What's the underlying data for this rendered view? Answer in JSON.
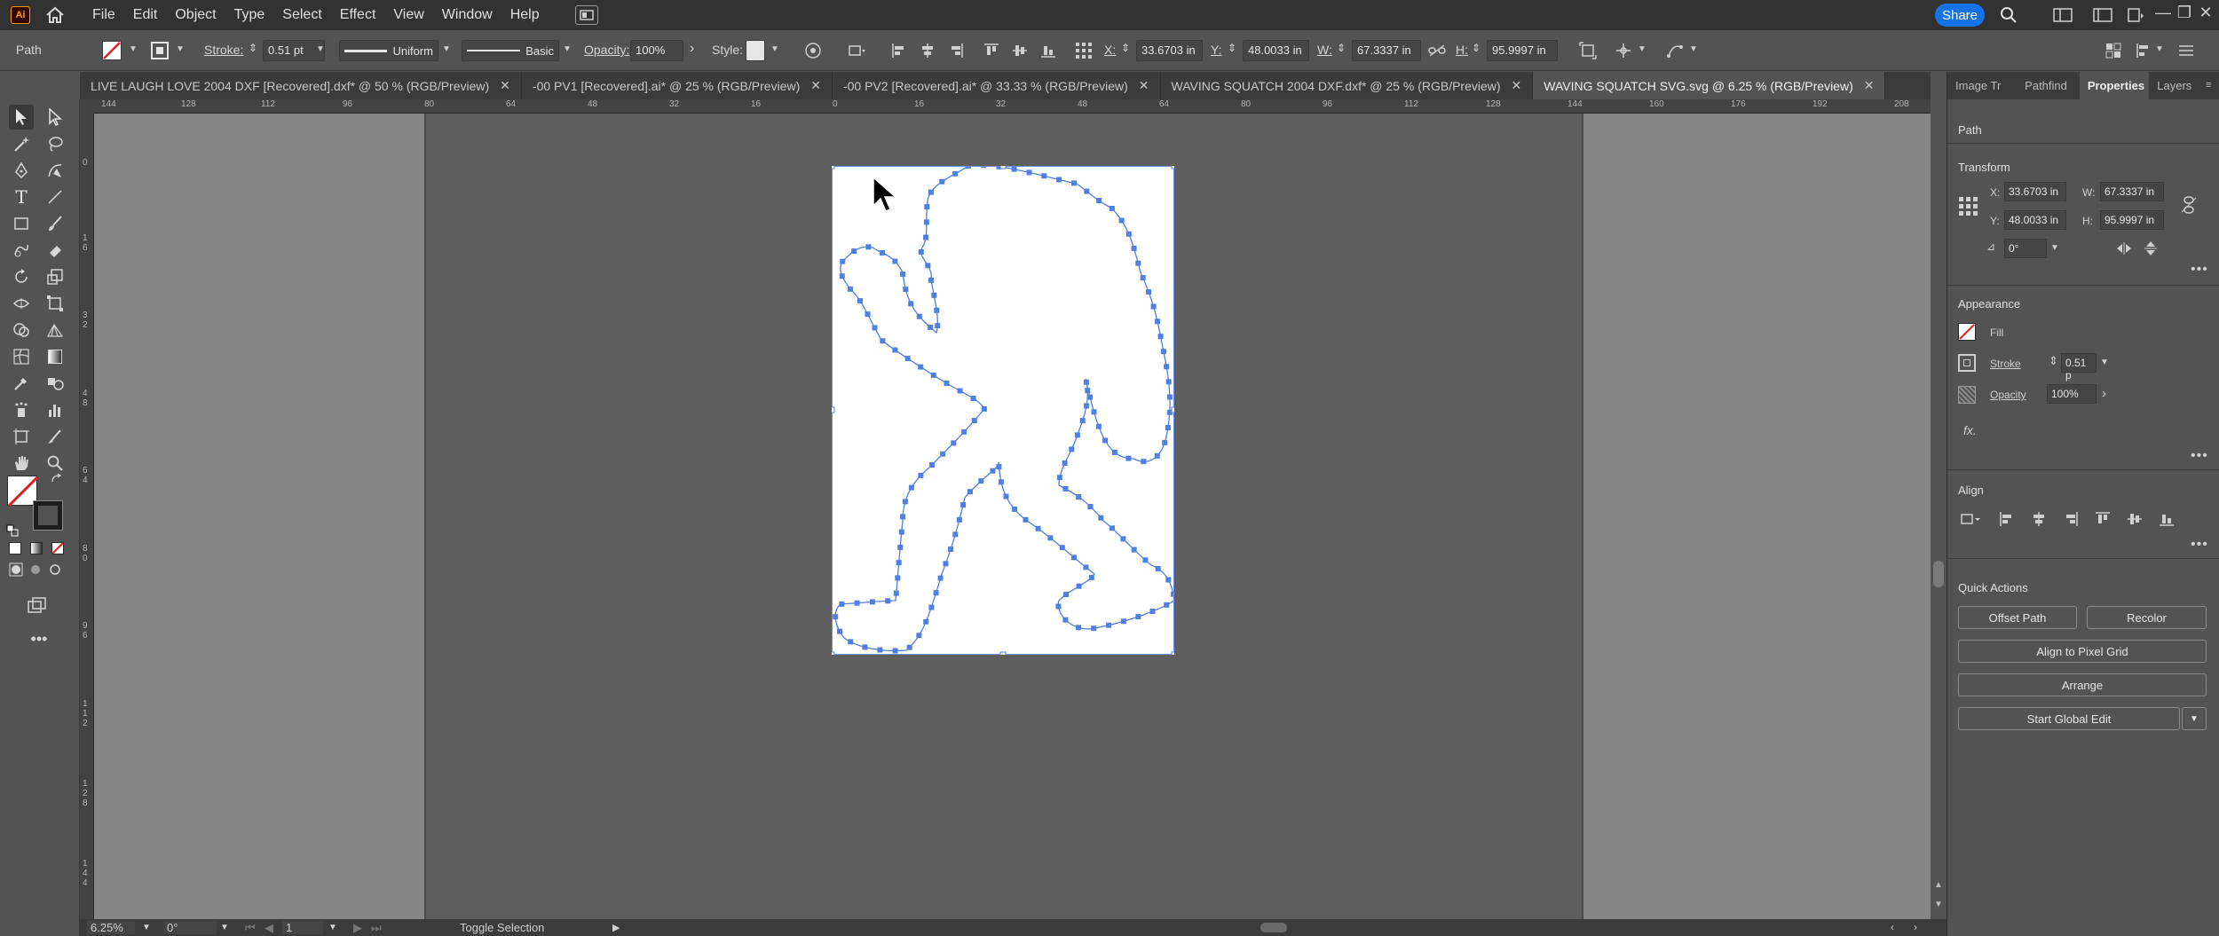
{
  "app": {
    "logo": "Ai",
    "menu": [
      "File",
      "Edit",
      "Object",
      "Type",
      "Select",
      "Effect",
      "View",
      "Window",
      "Help"
    ],
    "share_label": "Share"
  },
  "control": {
    "selection_type": "Path",
    "stroke_label": "Stroke:",
    "stroke_value": "0.51 pt",
    "stroke_profile": "Uniform",
    "brush": "Basic",
    "opacity_label": "Opacity:",
    "opacity_value": "100%",
    "style_label": "Style:",
    "x_label": "X:",
    "x_value": "33.6703 in",
    "y_label": "Y:",
    "y_value": "48.0033 in",
    "w_label": "W:",
    "w_value": "67.3337 in",
    "h_label": "H:",
    "h_value": "95.9997 in"
  },
  "tabs": [
    {
      "label": "LIVE LAUGH LOVE 2004 DXF [Recovered].dxf* @ 50 % (RGB/Preview)",
      "active": false
    },
    {
      "label": "-00 PV1 [Recovered].ai* @ 25 % (RGB/Preview)",
      "active": false
    },
    {
      "label": "-00 PV2 [Recovered].ai* @ 33.33 % (RGB/Preview)",
      "active": false
    },
    {
      "label": "WAVING SQUATCH 2004 DXF.dxf* @ 25 % (RGB/Preview)",
      "active": false
    },
    {
      "label": "WAVING SQUATCH SVG.svg @ 6.25 % (RGB/Preview)",
      "active": true
    }
  ],
  "ruler": {
    "h_ticks": [
      "144",
      "128",
      "112",
      "96",
      "80",
      "64",
      "48",
      "32",
      "16",
      "0",
      "16",
      "32",
      "48",
      "64",
      "80",
      "96",
      "112",
      "128",
      "144",
      "160",
      "176",
      "192",
      "208"
    ],
    "v_ticks": [
      "0",
      "1 6",
      "3 2",
      "4 8",
      "6 4",
      "8 0",
      "9 6",
      "1 1 2",
      "1 2 8",
      "1 4 4"
    ]
  },
  "status": {
    "zoom": "6.25%",
    "rotation": "0°",
    "artboard_num": "1",
    "message": "Toggle Selection"
  },
  "panel": {
    "tabs": [
      "Image Tr",
      "Pathfind",
      "Properties",
      "Layers"
    ],
    "active_tab": "Properties",
    "object_type": "Path",
    "transform_title": "Transform",
    "x_label": "X:",
    "x_value": "33.6703 in",
    "y_label": "Y:",
    "y_value": "48.0033 in",
    "w_label": "W:",
    "w_value": "67.3337 in",
    "h_label": "H:",
    "h_value": "95.9997 in",
    "angle_value": "0°",
    "appearance_title": "Appearance",
    "fill_label": "Fill",
    "stroke_label": "Stroke",
    "stroke_value": "0.51 p",
    "opacity_label": "Opacity",
    "opacity_value": "100%",
    "fx_label": "fx.",
    "align_title": "Align",
    "quick_actions_title": "Quick Actions",
    "offset_path": "Offset Path",
    "recolor": "Recolor",
    "align_pixel_grid": "Align to Pixel Grid",
    "arrange": "Arrange",
    "start_global_edit": "Start Global Edit"
  },
  "colors": {
    "accent": "#1473e6",
    "path": "#4f7fe0",
    "chrome_dark": "#323232",
    "chrome": "#535353"
  }
}
